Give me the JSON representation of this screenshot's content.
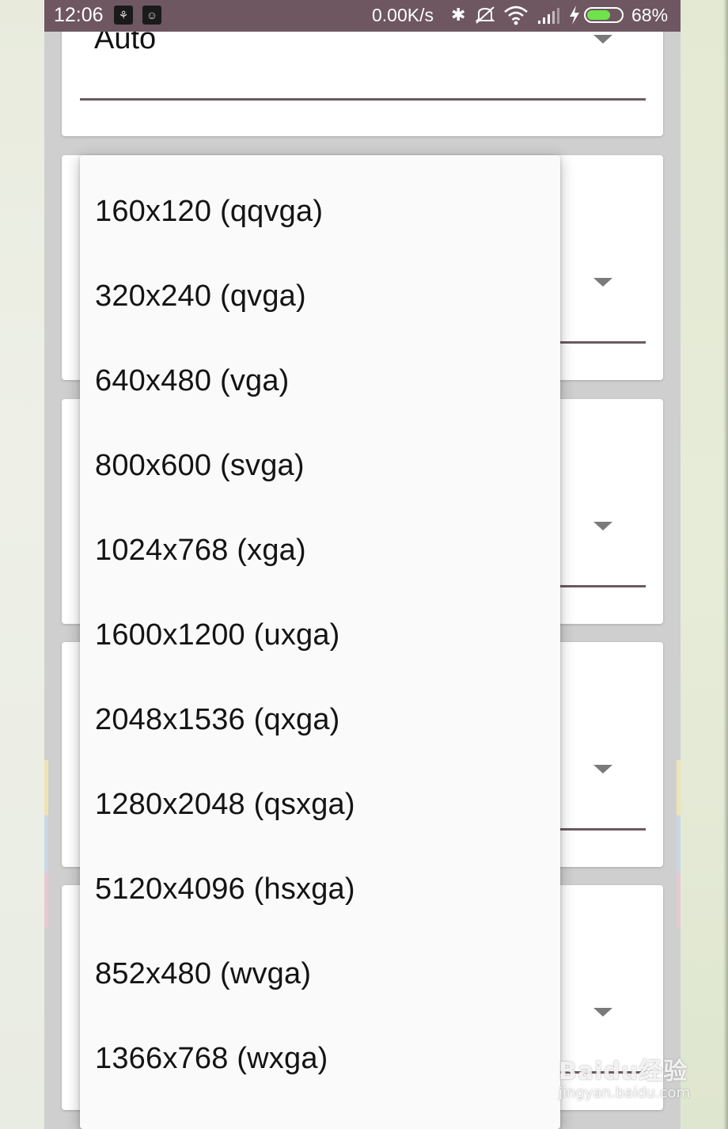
{
  "status_bar": {
    "time": "12:06",
    "net_speed": "0.00K/s",
    "battery_percent": "68%",
    "battery_level": 0.68,
    "icons": [
      "notification-app-icon",
      "notification-robot-icon",
      "bluetooth-icon",
      "mute-icon",
      "wifi-icon",
      "signal-icon",
      "charging-icon",
      "battery-icon"
    ]
  },
  "cards": [
    {
      "selected_value": "Auto"
    }
  ],
  "dropdown": {
    "options": [
      "160x120 (qqvga)",
      "320x240 (qvga)",
      "640x480 (vga)",
      "800x600 (svga)",
      "1024x768 (xga)",
      "1600x1200 (uxga)",
      "2048x1536 (qxga)",
      "1280x2048 (qsxga)",
      "5120x4096 (hsxga)",
      "852x480 (wvga)",
      "1366x768 (wxga)"
    ]
  },
  "watermark": {
    "main": "Baidu经验",
    "sub": "jingyan.baidu.com"
  },
  "colors": {
    "status_bar": "#6e5761",
    "underline": "#6b5a62",
    "card": "#ffffff",
    "backdrop": "#cfcfcf",
    "dropdown": "#fafafa"
  }
}
